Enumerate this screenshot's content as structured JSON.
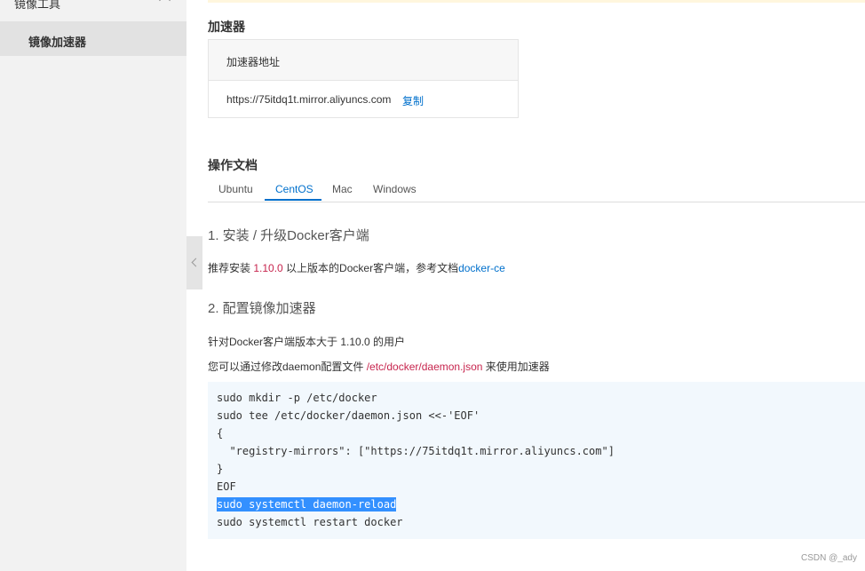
{
  "sidebar": {
    "group_label": "镜像工具",
    "active_item_label": "镜像加速器"
  },
  "accelerator": {
    "title": "加速器",
    "table_header": "加速器地址",
    "url": "https://75itdq1t.mirror.aliyuncs.com",
    "copy_label": "复制"
  },
  "docs": {
    "title": "操作文档",
    "tabs": [
      {
        "label": "Ubuntu",
        "active": false
      },
      {
        "label": "CentOS",
        "active": true
      },
      {
        "label": "Mac",
        "active": false
      },
      {
        "label": "Windows",
        "active": false
      }
    ]
  },
  "step1": {
    "title": "1. 安装 / 升级Docker客户端",
    "text_prefix": "推荐安装 ",
    "version": "1.10.0",
    "text_mid": " 以上版本的Docker客户端，参考文档",
    "doc_link": "docker-ce"
  },
  "step2": {
    "title": "2. 配置镜像加速器",
    "para1": "针对Docker客户端版本大于 1.10.0 的用户",
    "para2_prefix": "您可以通过修改daemon配置文件 ",
    "config_path": "/etc/docker/daemon.json",
    "para2_suffix": " 来使用加速器"
  },
  "code": {
    "lines": [
      "sudo mkdir -p /etc/docker",
      "sudo tee /etc/docker/daemon.json <<-'EOF'",
      "{",
      "  \"registry-mirrors\": [\"https://75itdq1t.mirror.aliyuncs.com\"]",
      "}",
      "EOF",
      "sudo systemctl daemon-reload",
      "sudo systemctl restart docker"
    ],
    "selected_line": "sudo systemctl daemon-reload"
  },
  "watermark": "CSDN @_ady",
  "colors": {
    "link": "#0070cc",
    "emphasis": "#c7254e",
    "selection": "#3390ff"
  }
}
